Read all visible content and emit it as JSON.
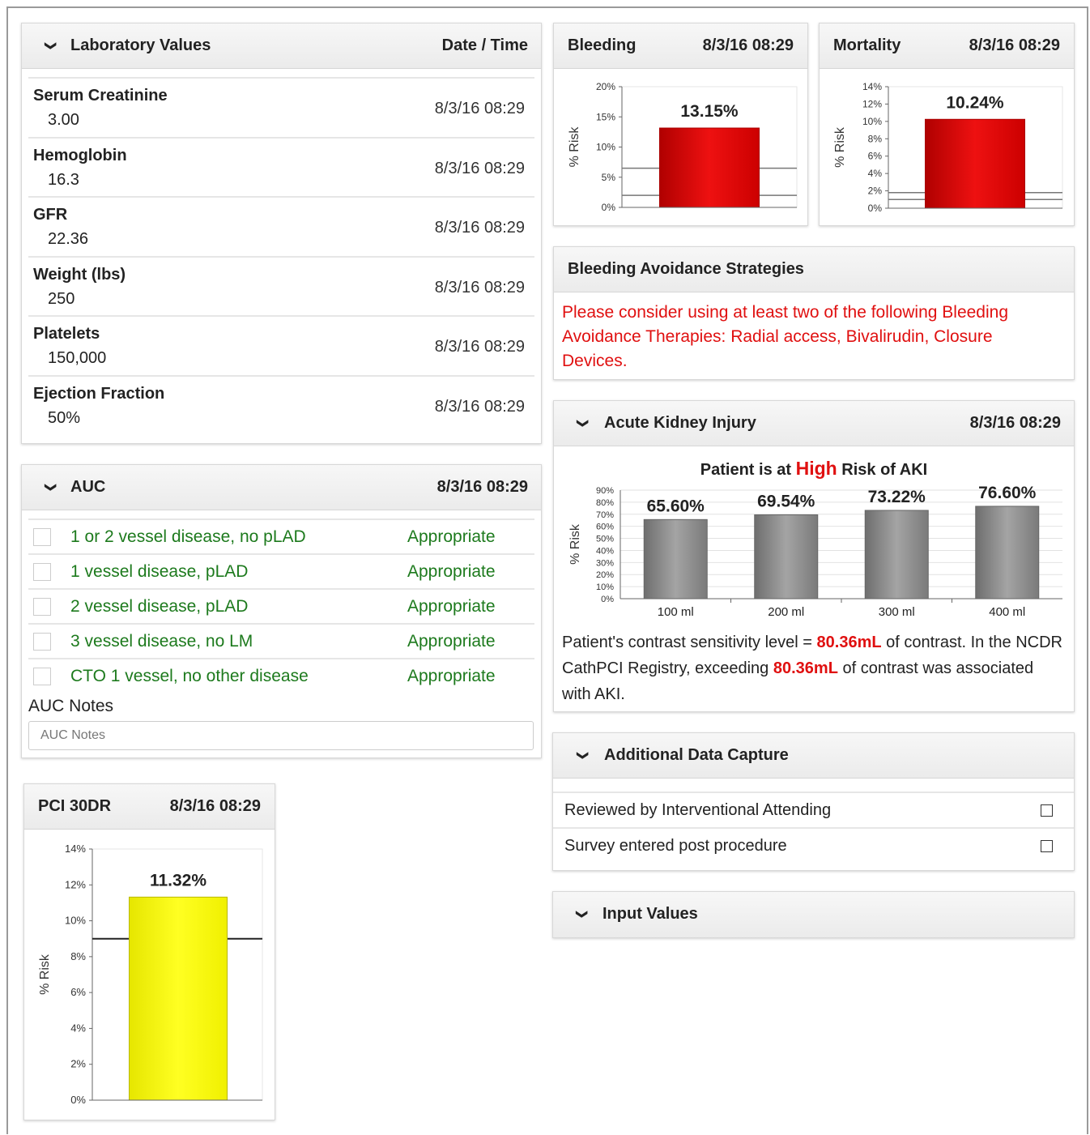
{
  "colors": {
    "risk_red": "#ee1111",
    "aki_bar": "#8c8c8c",
    "pci_yellow": "#ffff22",
    "auc_green": "#1d7a1d",
    "alert_red": "#e01010"
  },
  "lab": {
    "title": "Laboratory Values",
    "date_header": "Date / Time",
    "rows": [
      {
        "name": "Serum Creatinine",
        "value": "3.00",
        "date": "8/3/16 08:29"
      },
      {
        "name": "Hemoglobin",
        "value": "16.3",
        "date": "8/3/16 08:29"
      },
      {
        "name": "GFR",
        "value": "22.36",
        "date": "8/3/16 08:29"
      },
      {
        "name": "Weight (lbs)",
        "value": "250",
        "date": "8/3/16 08:29"
      },
      {
        "name": "Platelets",
        "value": "150,000",
        "date": "8/3/16 08:29"
      },
      {
        "name": "Ejection Fraction",
        "value": "50%",
        "date": "8/3/16 08:29"
      }
    ]
  },
  "auc": {
    "title": "AUC",
    "date": "8/3/16 08:29",
    "rows": [
      {
        "label": "1 or 2 vessel disease, no pLAD",
        "status": "Appropriate"
      },
      {
        "label": "1 vessel disease, pLAD",
        "status": "Appropriate"
      },
      {
        "label": "2 vessel disease, pLAD",
        "status": "Appropriate"
      },
      {
        "label": "3 vessel disease, no LM",
        "status": "Appropriate"
      },
      {
        "label": "CTO 1 vessel, no other disease",
        "status": "Appropriate"
      }
    ],
    "notes_label": "AUC Notes",
    "notes_placeholder": "AUC Notes"
  },
  "bleeding": {
    "title": "Bleeding",
    "date": "8/3/16 08:29"
  },
  "mortality": {
    "title": "Mortality",
    "date": "8/3/16 08:29"
  },
  "pci": {
    "title": "PCI 30DR",
    "date": "8/3/16 08:29"
  },
  "bas": {
    "title": "Bleeding Avoidance Strategies",
    "message": "Please consider using at least two of the following Bleeding Avoidance Therapies: Radial access, Bivalirudin, Closure Devices."
  },
  "aki": {
    "title": "Acute Kidney Injury",
    "date": "8/3/16 08:29",
    "risk_prefix": "Patient is at ",
    "risk_level": "High",
    "risk_suffix": " Risk of AKI",
    "text_1": "Patient's contrast sensitivity level = ",
    "threshold": "80.36mL",
    "text_2": " of contrast. In the NCDR CathPCI Registry, exceeding ",
    "text_3": " of contrast was associated with AKI."
  },
  "adc": {
    "title": "Additional Data Capture",
    "rows": [
      {
        "label": "Reviewed by Interventional Attending"
      },
      {
        "label": "Survey entered post procedure"
      }
    ]
  },
  "input_values": {
    "title": "Input Values"
  },
  "chart_data": [
    {
      "id": "bleeding",
      "type": "bar",
      "ylabel": "% Risk",
      "ylim": [
        0,
        20
      ],
      "ticks": [
        "0%",
        "5%",
        "10%",
        "15%",
        "20%"
      ],
      "values": [
        13.15
      ],
      "data_labels": [
        "13.15%"
      ],
      "reference_lines": [
        2,
        6.5
      ],
      "color": "#ee1111"
    },
    {
      "id": "mortality",
      "type": "bar",
      "ylabel": "% Risk",
      "ylim": [
        0,
        14
      ],
      "ticks": [
        "0%",
        "2%",
        "4%",
        "6%",
        "8%",
        "10%",
        "12%",
        "14%"
      ],
      "values": [
        10.24
      ],
      "data_labels": [
        "10.24%"
      ],
      "reference_lines": [
        1,
        1.8
      ],
      "color": "#ee1111"
    },
    {
      "id": "aki",
      "type": "bar",
      "ylabel": "% Risk",
      "ylim": [
        0,
        90
      ],
      "ticks": [
        "0%",
        "10%",
        "20%",
        "30%",
        "40%",
        "50%",
        "60%",
        "70%",
        "80%",
        "90%"
      ],
      "categories": [
        "100 ml",
        "200 ml",
        "300 ml",
        "400 ml"
      ],
      "values": [
        65.6,
        69.54,
        73.22,
        76.6
      ],
      "data_labels": [
        "65.60%",
        "69.54%",
        "73.22%",
        "76.60%"
      ],
      "color": "#8c8c8c"
    },
    {
      "id": "pci",
      "type": "bar",
      "ylabel": "% Risk",
      "ylim": [
        0,
        14
      ],
      "ticks": [
        "0%",
        "2%",
        "4%",
        "6%",
        "8%",
        "10%",
        "12%",
        "14%"
      ],
      "values": [
        11.32
      ],
      "data_labels": [
        "11.32%"
      ],
      "reference_lines": [
        9
      ],
      "color": "#ffff22"
    }
  ]
}
